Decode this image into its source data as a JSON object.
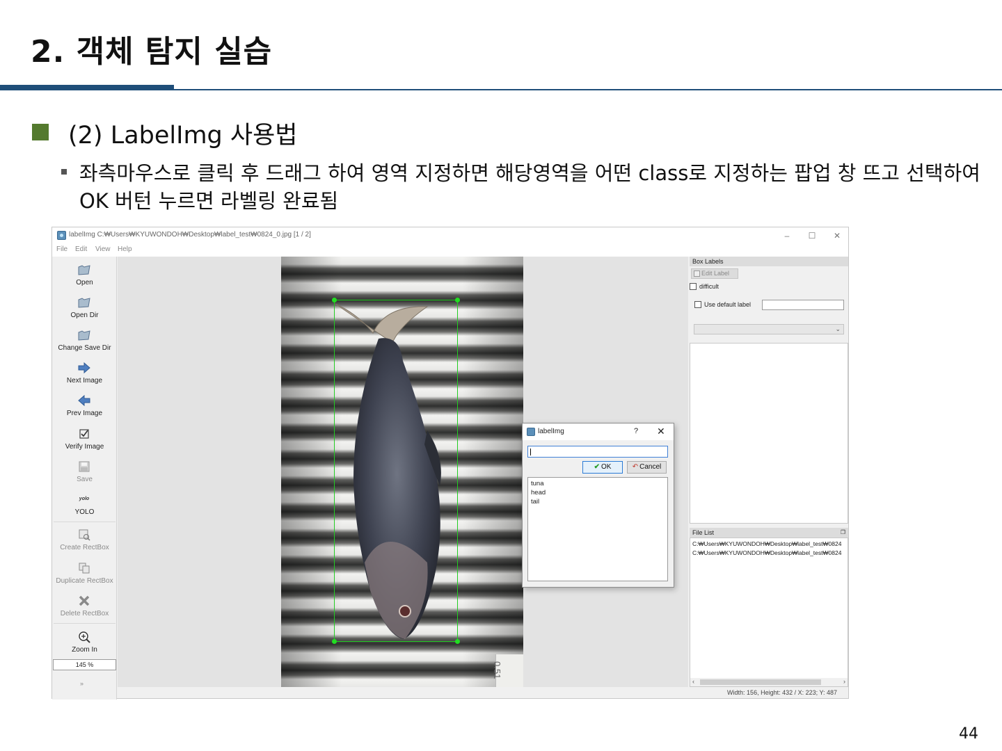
{
  "slide": {
    "title": "2. 객체 탐지 실습",
    "heading": "(2) LabelImg 사용법",
    "description": "좌측마우스로 클릭 후 드래그 하여 영역 지정하면 해당영역을 어떤 class로 지정하는 팝업 창 뜨고 선택하여 OK 버턴 누르면 라벨링 완료됨",
    "page_number": "44",
    "accent_color": "#1f4e79",
    "bullet_color": "#547a2e"
  },
  "window": {
    "title": "labelImg C:₩Users₩KYUWONDOH₩Desktop₩label_test₩0824_0.jpg [1 / 2]",
    "controls": {
      "minimize": "–",
      "maximize": "☐",
      "close": "✕"
    },
    "menu": [
      "File",
      "Edit",
      "View",
      "Help"
    ]
  },
  "toolbar": {
    "tools": [
      {
        "label": "Open",
        "icon": "folder-icon"
      },
      {
        "label": "Open Dir",
        "icon": "folder-icon"
      },
      {
        "label": "Change Save Dir",
        "icon": "folder-icon"
      },
      {
        "label": "Next Image",
        "icon": "arrow-right-icon"
      },
      {
        "label": "Prev Image",
        "icon": "arrow-left-icon"
      },
      {
        "label": "Verify Image",
        "icon": "checkbox-icon"
      },
      {
        "label": "Save",
        "icon": "save-icon"
      },
      {
        "label": "YOLO",
        "icon_text": "yolo"
      },
      {
        "label": "Create RectBox",
        "icon": "create-rect-icon"
      },
      {
        "label": "Duplicate RectBox",
        "icon": "duplicate-icon"
      },
      {
        "label": "Delete RectBox",
        "icon": "delete-icon"
      },
      {
        "label": "Zoom In",
        "icon": "zoom-in-icon"
      }
    ],
    "zoom_value": "145 %",
    "more": "»"
  },
  "right_panel": {
    "box_labels_title": "Box Labels",
    "edit_label": "Edit Label",
    "difficult": "difficult",
    "use_default_label": "Use default label",
    "file_list_title": "File List",
    "files": [
      "C:₩Users₩KYUWONDOH₩Desktop₩label_test₩0824",
      "C:₩Users₩KYUWONDOH₩Desktop₩label_test₩0824"
    ]
  },
  "canvas": {
    "tag_text": "0.51"
  },
  "status": {
    "text": "Width: 156, Height: 432 / X: 223; Y: 487"
  },
  "dialog": {
    "title": "labelImg",
    "help": "?",
    "close": "✕",
    "ok_label": "OK",
    "cancel_label": "Cancel",
    "classes": [
      "tuna",
      "head",
      "tail"
    ]
  }
}
